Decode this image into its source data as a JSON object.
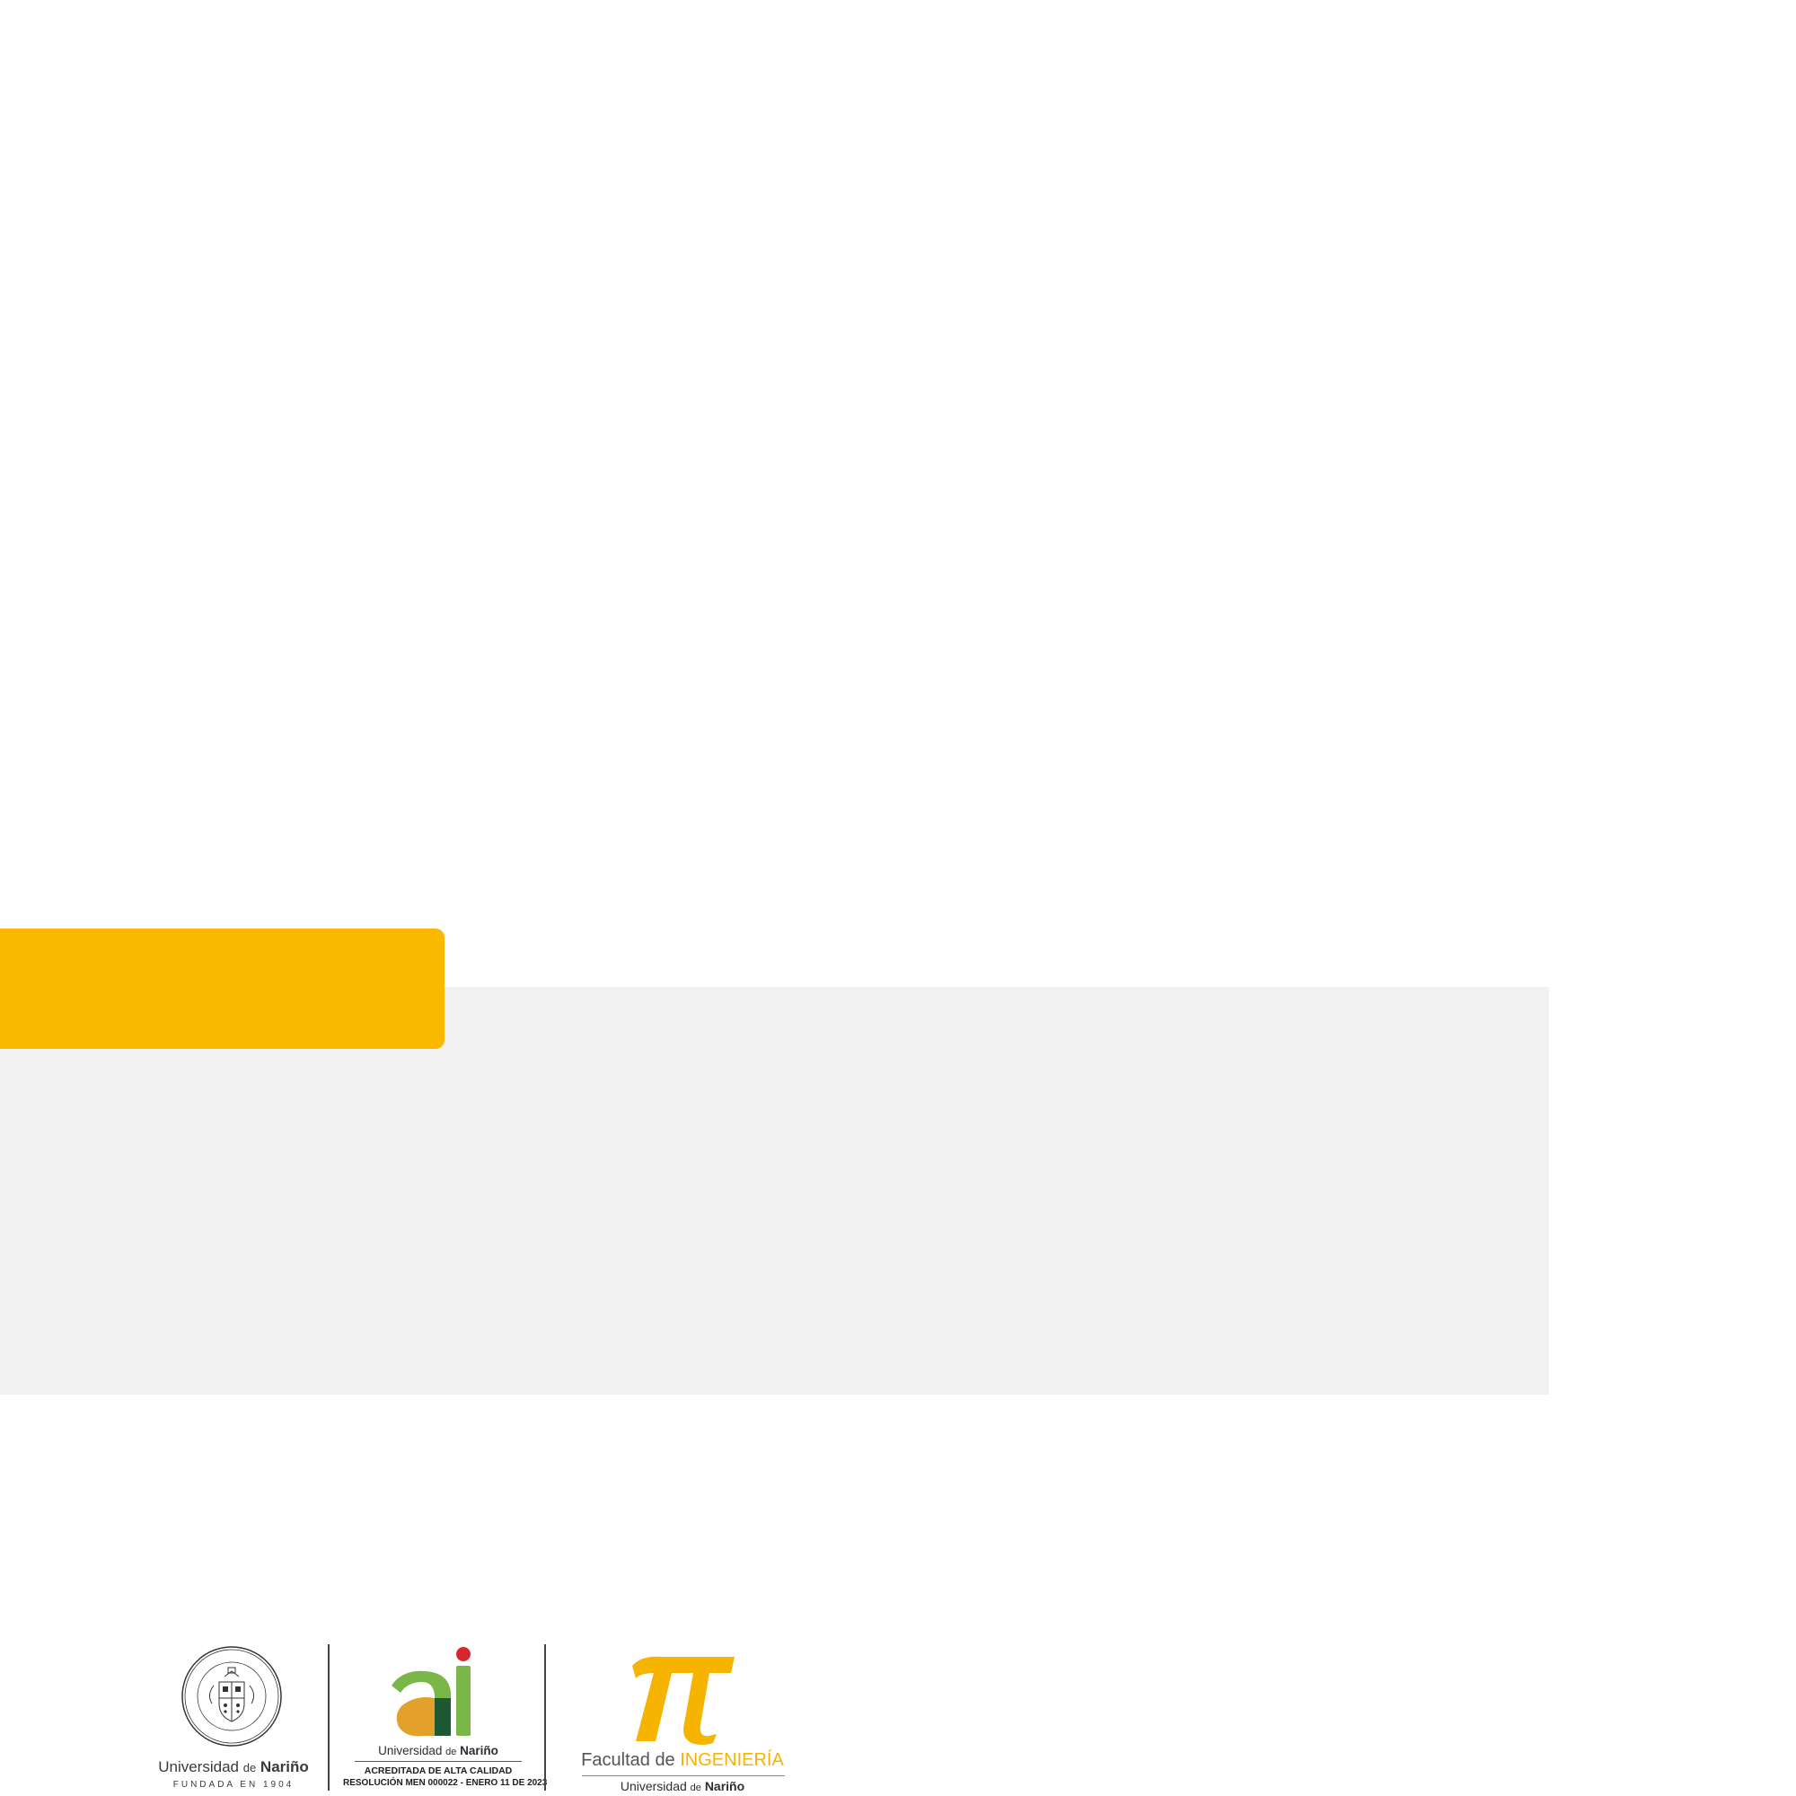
{
  "colors": {
    "accent": "#fbb800",
    "panel": "#f1f1f1",
    "ai_green_dark": "#1d5a33",
    "ai_green_light": "#7ab648",
    "ai_orange": "#e3a12c",
    "ai_red_dot": "#d8262e",
    "pi_yellow": "#f6b400"
  },
  "logos": {
    "udenar": {
      "icon": "university-seal",
      "seal_motto_top": "TANTUM POSSUMUS QUANTUM SCIMUS",
      "seal_motto_bottom": "UNIVERSIDAD DE NARIÑO",
      "name_prefix": "Universidad",
      "name_de": "de",
      "name_main": "Nariño",
      "founded": "FUNDADA EN 1904"
    },
    "accreditation": {
      "icon": "ai-monogram",
      "uni_prefix": "Universidad",
      "uni_de": "de",
      "uni_main": "Nariño",
      "accredited": "ACREDITADA DE ALTA CALIDAD",
      "resolution": "RESOLUCIÓN MEN 000022 - ENERO 11 DE 2023"
    },
    "faculty": {
      "icon": "pi-symbol",
      "faculty_prefix": "Facultad de",
      "faculty_name": "INGENIERÍA",
      "uni_prefix": "Universidad",
      "uni_de": "de",
      "uni_main": "Nariño"
    }
  }
}
